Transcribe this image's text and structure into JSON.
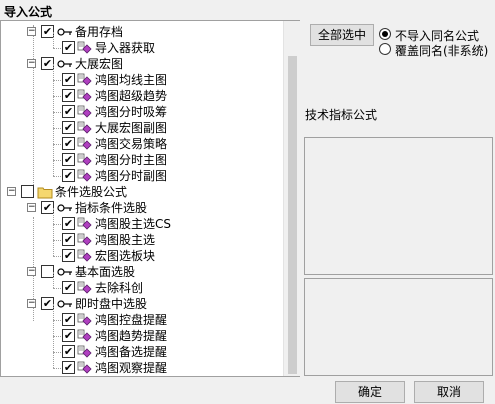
{
  "window": {
    "title": "导入公式"
  },
  "tree": [
    {
      "label": "备用存档",
      "type": "branch",
      "expander": "−",
      "checked": true
    },
    {
      "label": "导入器获取",
      "type": "leaf",
      "checked": true
    },
    {
      "label": "大展宏图",
      "type": "branch",
      "expander": "−",
      "checked": true
    },
    {
      "label": "鸿图均线主图",
      "type": "leaf",
      "checked": true
    },
    {
      "label": "鸿图超级趋势",
      "type": "leaf",
      "checked": true
    },
    {
      "label": "鸿图分时吸筹",
      "type": "leaf",
      "checked": true
    },
    {
      "label": "大展宏图副图",
      "type": "leaf",
      "checked": true
    },
    {
      "label": "鸿图交易策略",
      "type": "leaf",
      "checked": true
    },
    {
      "label": "鸿图分时主图",
      "type": "leaf",
      "checked": true
    },
    {
      "label": "鸿图分时副图",
      "type": "leaf",
      "checked": true
    },
    {
      "label": "条件选股公式",
      "type": "root",
      "expander": "−",
      "checked": false
    },
    {
      "label": "指标条件选股",
      "type": "branch",
      "expander": "−",
      "checked": true
    },
    {
      "label": "鸿图股主选CS",
      "type": "leaf",
      "checked": true
    },
    {
      "label": "鸿图股主选",
      "type": "leaf",
      "checked": true
    },
    {
      "label": "宏图选板块",
      "type": "leaf",
      "checked": true
    },
    {
      "label": "基本面选股",
      "type": "branch",
      "expander": "−",
      "checked": false
    },
    {
      "label": "去除科创",
      "type": "leaf",
      "checked": true
    },
    {
      "label": "即时盘中选股",
      "type": "branch",
      "expander": "−",
      "checked": true
    },
    {
      "label": "鸿图控盘提醒",
      "type": "leaf",
      "checked": true
    },
    {
      "label": "鸿图趋势提醒",
      "type": "leaf",
      "checked": true
    },
    {
      "label": "鸿图备选提醒",
      "type": "leaf",
      "checked": true
    },
    {
      "label": "鸿图观察提醒",
      "type": "leaf",
      "checked": true
    }
  ],
  "right": {
    "select_all": "全部选中",
    "radio_skip": "不导入同名公式",
    "radio_overwrite": "覆盖同名(非系统)",
    "section_label": "技术指标公式"
  },
  "footer": {
    "ok": "确定",
    "cancel": "取消"
  },
  "icons": {
    "check": "✔"
  },
  "colors": {
    "folder": "#f5d76e",
    "formula_icon": "#b040c0"
  }
}
